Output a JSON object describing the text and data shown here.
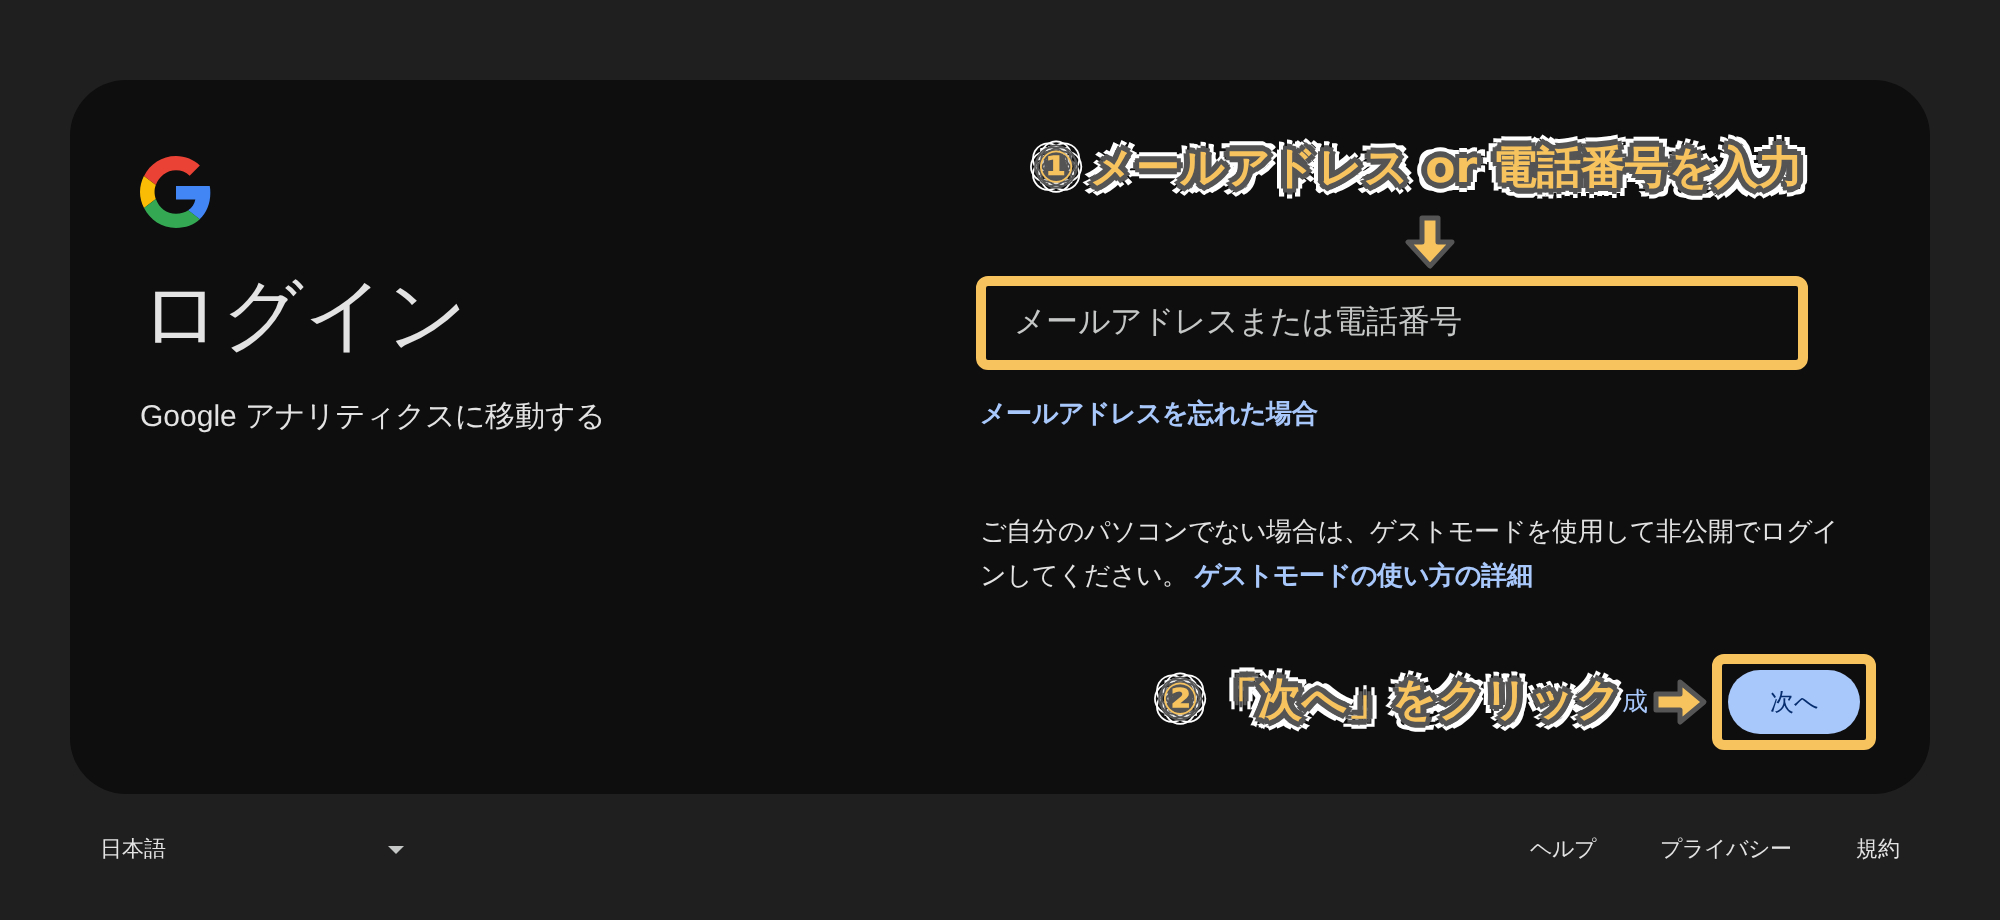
{
  "card": {
    "title": "ログイン",
    "subtitle": "Google アナリティクスに移動する"
  },
  "email_field": {
    "placeholder": "メールアドレスまたは電話番号",
    "highlighted": true
  },
  "forgot_link": "メールアドレスを忘れた場合",
  "guest_notice": {
    "text": "ご自分のパソコンでない場合は、ゲストモードを使用して非公開でログインしてください。",
    "link": "ゲストモードの使い方の詳細"
  },
  "create_account_fragment": "成",
  "next_button": {
    "label": "次へ",
    "highlighted": true
  },
  "annotations": [
    {
      "text": "① メールアドレス or 電話番号を入力"
    },
    {
      "text": "② 「次へ」をクリック"
    }
  ],
  "footer": {
    "language": "日本語",
    "links": [
      "ヘルプ",
      "プライバシー",
      "規約"
    ]
  }
}
